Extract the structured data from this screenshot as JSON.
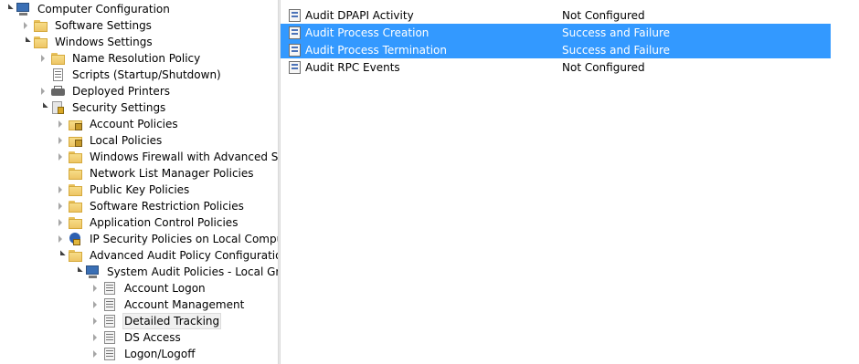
{
  "tree": {
    "nodes": [
      {
        "label": "Computer Configuration",
        "icon": "computer-icon",
        "expand": "open"
      },
      {
        "label": "Software Settings",
        "icon": "folder-icon",
        "expand": "closed"
      },
      {
        "label": "Windows Settings",
        "icon": "folder-icon",
        "expand": "open"
      },
      {
        "label": "Name Resolution Policy",
        "icon": "folder-icon",
        "expand": "closed"
      },
      {
        "label": "Scripts (Startup/Shutdown)",
        "icon": "script-icon",
        "expand": "none"
      },
      {
        "label": "Deployed Printers",
        "icon": "printer-icon",
        "expand": "closed"
      },
      {
        "label": "Security Settings",
        "icon": "security-settings-icon",
        "expand": "open"
      },
      {
        "label": "Account Policies",
        "icon": "locked-folder-icon",
        "expand": "closed"
      },
      {
        "label": "Local Policies",
        "icon": "locked-folder-icon",
        "expand": "closed"
      },
      {
        "label": "Windows Firewall with Advanced Secu",
        "icon": "folder-icon",
        "expand": "closed"
      },
      {
        "label": "Network List Manager Policies",
        "icon": "folder-icon",
        "expand": "none"
      },
      {
        "label": "Public Key Policies",
        "icon": "folder-icon",
        "expand": "closed"
      },
      {
        "label": "Software Restriction Policies",
        "icon": "folder-icon",
        "expand": "closed"
      },
      {
        "label": "Application Control Policies",
        "icon": "folder-icon",
        "expand": "closed"
      },
      {
        "label": "IP Security Policies on Local Computer",
        "icon": "ip-security-icon",
        "expand": "closed"
      },
      {
        "label": "Advanced Audit Policy Configuration",
        "icon": "folder-icon",
        "expand": "open"
      },
      {
        "label": "System Audit Policies - Local Group",
        "icon": "computer-icon",
        "expand": "open"
      },
      {
        "label": "Account Logon",
        "icon": "audit-category-icon",
        "expand": "closed"
      },
      {
        "label": "Account Management",
        "icon": "audit-category-icon",
        "expand": "closed"
      },
      {
        "label": "Detailed Tracking",
        "icon": "audit-category-icon",
        "expand": "closed",
        "selected": true
      },
      {
        "label": "DS Access",
        "icon": "audit-category-icon",
        "expand": "closed"
      },
      {
        "label": "Logon/Logoff",
        "icon": "audit-category-icon",
        "expand": "closed"
      }
    ]
  },
  "list": {
    "rows": [
      {
        "name": "Audit DPAPI Activity",
        "setting": "Not Configured",
        "selected": false
      },
      {
        "name": "Audit Process Creation",
        "setting": "Success and Failure",
        "selected": true
      },
      {
        "name": "Audit Process Termination",
        "setting": "Success and Failure",
        "selected": true
      },
      {
        "name": "Audit RPC Events",
        "setting": "Not Configured",
        "selected": false
      }
    ]
  },
  "colors": {
    "selection": "#3399ff",
    "tree_selection": "#f0f0f0"
  }
}
